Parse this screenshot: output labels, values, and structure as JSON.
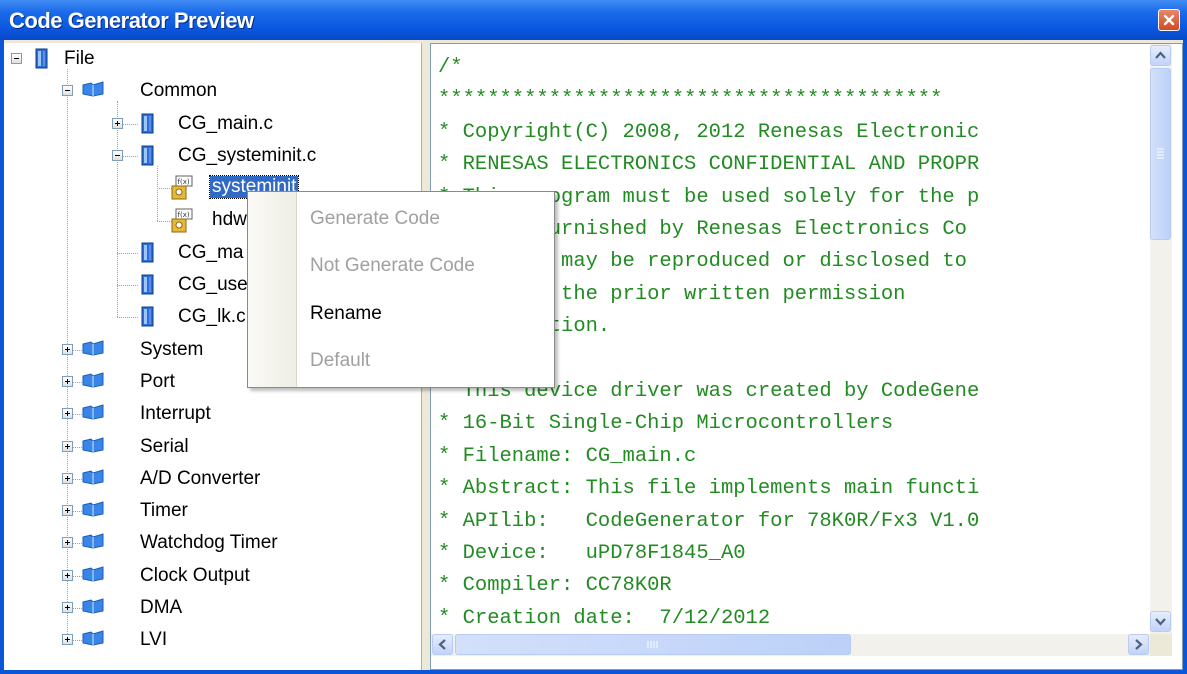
{
  "window": {
    "title": "Code Generator Preview",
    "close_icon": "close-icon",
    "accent_color": "#0a55d8"
  },
  "tree": {
    "root": {
      "label": "File",
      "icon": "file-module-icon"
    },
    "common": {
      "label": "Common",
      "icon": "folder-icon"
    },
    "common_files": [
      {
        "label": "CG_main.c",
        "icon": "file-module-icon"
      },
      {
        "label": "CG_systeminit.c",
        "icon": "file-module-icon"
      },
      {
        "label": "systeminit",
        "icon": "function-icon",
        "selected": true
      },
      {
        "label": "hdw",
        "icon": "function-icon"
      },
      {
        "label": "CG_ma",
        "icon": "file-module-icon"
      },
      {
        "label": "CG_use",
        "icon": "file-module-icon"
      },
      {
        "label": "CG_lk.c",
        "icon": "file-module-icon"
      }
    ],
    "folders": [
      "System",
      "Port",
      "Interrupt",
      "Serial",
      "A/D Converter",
      "Timer",
      "Watchdog Timer",
      "Clock Output",
      "DMA",
      "LVI"
    ]
  },
  "context_menu": {
    "items": [
      {
        "label": "Generate Code",
        "enabled": false
      },
      {
        "label": "Not Generate Code",
        "enabled": false
      },
      {
        "label": "Rename",
        "enabled": true
      },
      {
        "label": "Default",
        "enabled": false
      }
    ]
  },
  "code": {
    "text_color": "#228b22",
    "lines": [
      "/*",
      "*****************************************",
      "* Copyright(C) 2008, 2012 Renesas Electronic",
      "* RENESAS ELECTRONICS CONFIDENTIAL AND PROPR",
      "* This program must be used solely for the p",
      "* It is furnished by Renesas Electronics Co",
      "* program may be reproduced or disclosed to",
      "* without the prior written permission",
      "* Corporation.",
      "*",
      "* This device driver was created by CodeGene",
      "* 16-Bit Single-Chip Microcontrollers",
      "* Filename: CG_main.c",
      "* Abstract: This file implements main functi",
      "* APIlib:   CodeGenerator for 78K0R/Fx3 V1.0",
      "* Device:   uPD78F1845_A0",
      "* Compiler: CC78K0R",
      "* Creation date:  7/12/2012"
    ]
  }
}
